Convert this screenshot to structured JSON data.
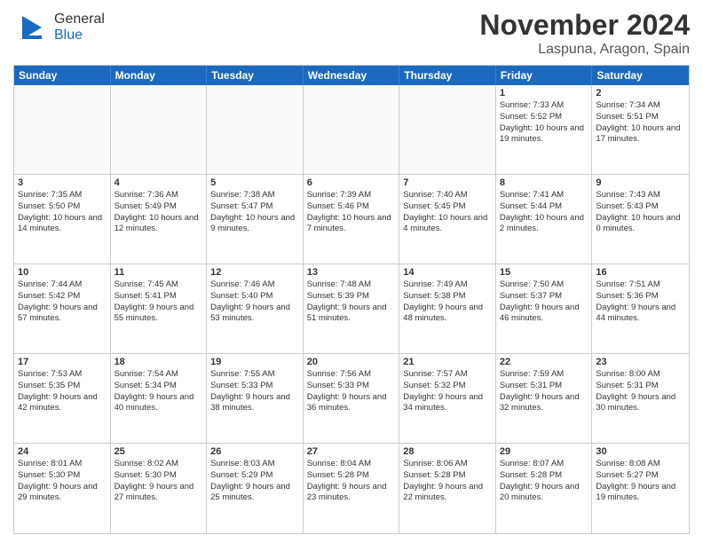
{
  "header": {
    "logo_general": "General",
    "logo_blue": "Blue",
    "title": "November 2024",
    "subtitle": "Laspuna, Aragon, Spain"
  },
  "calendar": {
    "days_of_week": [
      "Sunday",
      "Monday",
      "Tuesday",
      "Wednesday",
      "Thursday",
      "Friday",
      "Saturday"
    ],
    "weeks": [
      [
        {
          "day": "",
          "info": ""
        },
        {
          "day": "",
          "info": ""
        },
        {
          "day": "",
          "info": ""
        },
        {
          "day": "",
          "info": ""
        },
        {
          "day": "",
          "info": ""
        },
        {
          "day": "1",
          "info": "Sunrise: 7:33 AM\nSunset: 5:52 PM\nDaylight: 10 hours and 19 minutes."
        },
        {
          "day": "2",
          "info": "Sunrise: 7:34 AM\nSunset: 5:51 PM\nDaylight: 10 hours and 17 minutes."
        }
      ],
      [
        {
          "day": "3",
          "info": "Sunrise: 7:35 AM\nSunset: 5:50 PM\nDaylight: 10 hours and 14 minutes."
        },
        {
          "day": "4",
          "info": "Sunrise: 7:36 AM\nSunset: 5:49 PM\nDaylight: 10 hours and 12 minutes."
        },
        {
          "day": "5",
          "info": "Sunrise: 7:38 AM\nSunset: 5:47 PM\nDaylight: 10 hours and 9 minutes."
        },
        {
          "day": "6",
          "info": "Sunrise: 7:39 AM\nSunset: 5:46 PM\nDaylight: 10 hours and 7 minutes."
        },
        {
          "day": "7",
          "info": "Sunrise: 7:40 AM\nSunset: 5:45 PM\nDaylight: 10 hours and 4 minutes."
        },
        {
          "day": "8",
          "info": "Sunrise: 7:41 AM\nSunset: 5:44 PM\nDaylight: 10 hours and 2 minutes."
        },
        {
          "day": "9",
          "info": "Sunrise: 7:43 AM\nSunset: 5:43 PM\nDaylight: 10 hours and 0 minutes."
        }
      ],
      [
        {
          "day": "10",
          "info": "Sunrise: 7:44 AM\nSunset: 5:42 PM\nDaylight: 9 hours and 57 minutes."
        },
        {
          "day": "11",
          "info": "Sunrise: 7:45 AM\nSunset: 5:41 PM\nDaylight: 9 hours and 55 minutes."
        },
        {
          "day": "12",
          "info": "Sunrise: 7:46 AM\nSunset: 5:40 PM\nDaylight: 9 hours and 53 minutes."
        },
        {
          "day": "13",
          "info": "Sunrise: 7:48 AM\nSunset: 5:39 PM\nDaylight: 9 hours and 51 minutes."
        },
        {
          "day": "14",
          "info": "Sunrise: 7:49 AM\nSunset: 5:38 PM\nDaylight: 9 hours and 48 minutes."
        },
        {
          "day": "15",
          "info": "Sunrise: 7:50 AM\nSunset: 5:37 PM\nDaylight: 9 hours and 46 minutes."
        },
        {
          "day": "16",
          "info": "Sunrise: 7:51 AM\nSunset: 5:36 PM\nDaylight: 9 hours and 44 minutes."
        }
      ],
      [
        {
          "day": "17",
          "info": "Sunrise: 7:53 AM\nSunset: 5:35 PM\nDaylight: 9 hours and 42 minutes."
        },
        {
          "day": "18",
          "info": "Sunrise: 7:54 AM\nSunset: 5:34 PM\nDaylight: 9 hours and 40 minutes."
        },
        {
          "day": "19",
          "info": "Sunrise: 7:55 AM\nSunset: 5:33 PM\nDaylight: 9 hours and 38 minutes."
        },
        {
          "day": "20",
          "info": "Sunrise: 7:56 AM\nSunset: 5:33 PM\nDaylight: 9 hours and 36 minutes."
        },
        {
          "day": "21",
          "info": "Sunrise: 7:57 AM\nSunset: 5:32 PM\nDaylight: 9 hours and 34 minutes."
        },
        {
          "day": "22",
          "info": "Sunrise: 7:59 AM\nSunset: 5:31 PM\nDaylight: 9 hours and 32 minutes."
        },
        {
          "day": "23",
          "info": "Sunrise: 8:00 AM\nSunset: 5:31 PM\nDaylight: 9 hours and 30 minutes."
        }
      ],
      [
        {
          "day": "24",
          "info": "Sunrise: 8:01 AM\nSunset: 5:30 PM\nDaylight: 9 hours and 29 minutes."
        },
        {
          "day": "25",
          "info": "Sunrise: 8:02 AM\nSunset: 5:30 PM\nDaylight: 9 hours and 27 minutes."
        },
        {
          "day": "26",
          "info": "Sunrise: 8:03 AM\nSunset: 5:29 PM\nDaylight: 9 hours and 25 minutes."
        },
        {
          "day": "27",
          "info": "Sunrise: 8:04 AM\nSunset: 5:28 PM\nDaylight: 9 hours and 23 minutes."
        },
        {
          "day": "28",
          "info": "Sunrise: 8:06 AM\nSunset: 5:28 PM\nDaylight: 9 hours and 22 minutes."
        },
        {
          "day": "29",
          "info": "Sunrise: 8:07 AM\nSunset: 5:28 PM\nDaylight: 9 hours and 20 minutes."
        },
        {
          "day": "30",
          "info": "Sunrise: 8:08 AM\nSunset: 5:27 PM\nDaylight: 9 hours and 19 minutes."
        }
      ]
    ]
  }
}
